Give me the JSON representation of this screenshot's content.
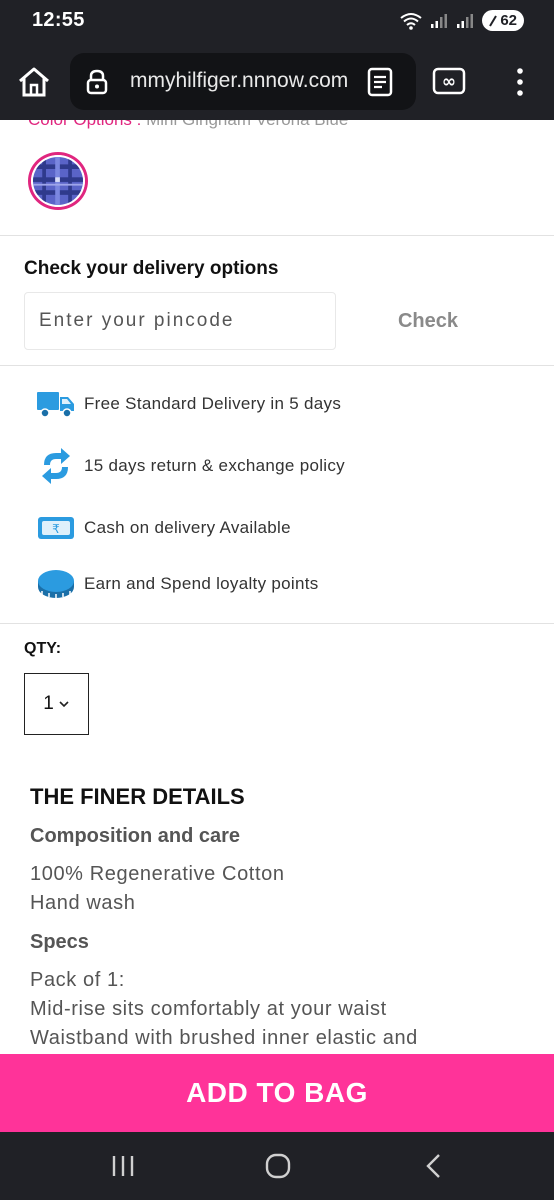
{
  "status_bar": {
    "time": "12:55",
    "battery": "62"
  },
  "browser": {
    "url": "mmyhilfiger.nnnow.com"
  },
  "product": {
    "color_label": "Color Options : ",
    "color_value": "Mini Gingham Verona Blue"
  },
  "delivery": {
    "title": "Check your delivery options",
    "pincode_placeholder": "Enter your pincode",
    "check_label": "Check"
  },
  "features": [
    {
      "icon": "truck-icon",
      "label": "Free Standard Delivery in 5 days"
    },
    {
      "icon": "return-icon",
      "label": "15 days return & exchange policy"
    },
    {
      "icon": "cash-icon",
      "label": "Cash on delivery Available"
    },
    {
      "icon": "coin-icon",
      "label": "Earn and Spend loyalty points"
    }
  ],
  "quantity": {
    "label": "QTY:",
    "value": "1"
  },
  "details": {
    "title": "THE FINER DETAILS",
    "composition_heading": "Composition and care",
    "composition_lines": [
      "100% Regenerative Cotton",
      "Hand wash"
    ],
    "specs_heading": "Specs",
    "specs_lines": [
      "Pack of 1:",
      "Mid-rise sits comfortably at your waist",
      "Waistband with brushed inner elastic and"
    ]
  },
  "actions": {
    "add_to_bag": "ADD TO BAG"
  },
  "colors": {
    "accent_pink": "#ff3399",
    "system_bar": "#202126",
    "icon_blue": "#2b9be0"
  }
}
